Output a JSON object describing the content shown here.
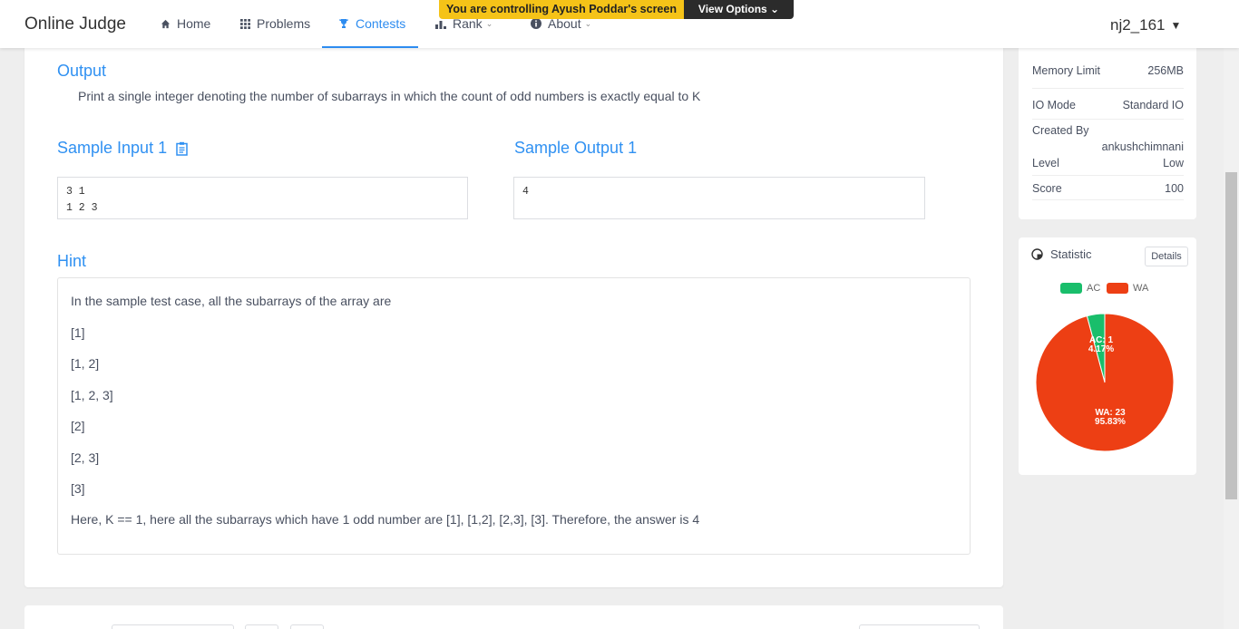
{
  "nav": {
    "brand": "Online Judge",
    "items": [
      {
        "label": "Home",
        "icon": "home-icon"
      },
      {
        "label": "Problems",
        "icon": "grid-icon"
      },
      {
        "label": "Contests",
        "icon": "trophy-icon"
      },
      {
        "label": "Rank",
        "icon": "bar-chart-icon"
      },
      {
        "label": "About",
        "icon": "info-icon"
      }
    ],
    "user": "nj2_161"
  },
  "banner": {
    "message": "You are controlling Ayush Poddar's screen",
    "options_label": "View Options ⌄"
  },
  "problem": {
    "output_title": "Output",
    "output_text": "Print a single integer denoting the number of subarrays in which the count of odd numbers is exactly equal to K",
    "sample_input_title": "Sample Input 1",
    "sample_output_title": "Sample Output 1",
    "sample_input": "3 1\n1 2 3",
    "sample_output": "4",
    "hint_title": "Hint",
    "hint_lines": [
      "In the sample test case, all the subarrays of the array are",
      "[1]",
      "[1, 2]",
      "[1, 2, 3]",
      "[2]",
      "[2, 3]",
      "[3]",
      "Here, K == 1, here all the subarrays which have 1 odd number are [1], [1,2], [2,3], [3]. Therefore, the answer is 4"
    ]
  },
  "info": {
    "rows": [
      {
        "label": "Memory Limit",
        "value": "256MB"
      },
      {
        "label": "IO Mode",
        "value": "Standard IO"
      },
      {
        "label": "Created By",
        "value": "ankushchimnani"
      },
      {
        "label": "Level",
        "value": "Low"
      },
      {
        "label": "Score",
        "value": "100"
      }
    ]
  },
  "statistic": {
    "title": "Statistic",
    "details_label": "Details",
    "legend": [
      {
        "name": "AC",
        "color": "#19be6b"
      },
      {
        "name": "WA",
        "color": "#ed3f14"
      }
    ],
    "chart_data": {
      "type": "pie",
      "slices": [
        {
          "name": "AC",
          "count": 1,
          "percent": 4.17,
          "label_count": "AC: 1",
          "label_percent": "4.17%",
          "color": "#19be6b"
        },
        {
          "name": "WA",
          "count": 23,
          "percent": 95.83,
          "label_count": "WA: 23",
          "label_percent": "95.83%",
          "color": "#ed3f14"
        }
      ]
    }
  }
}
